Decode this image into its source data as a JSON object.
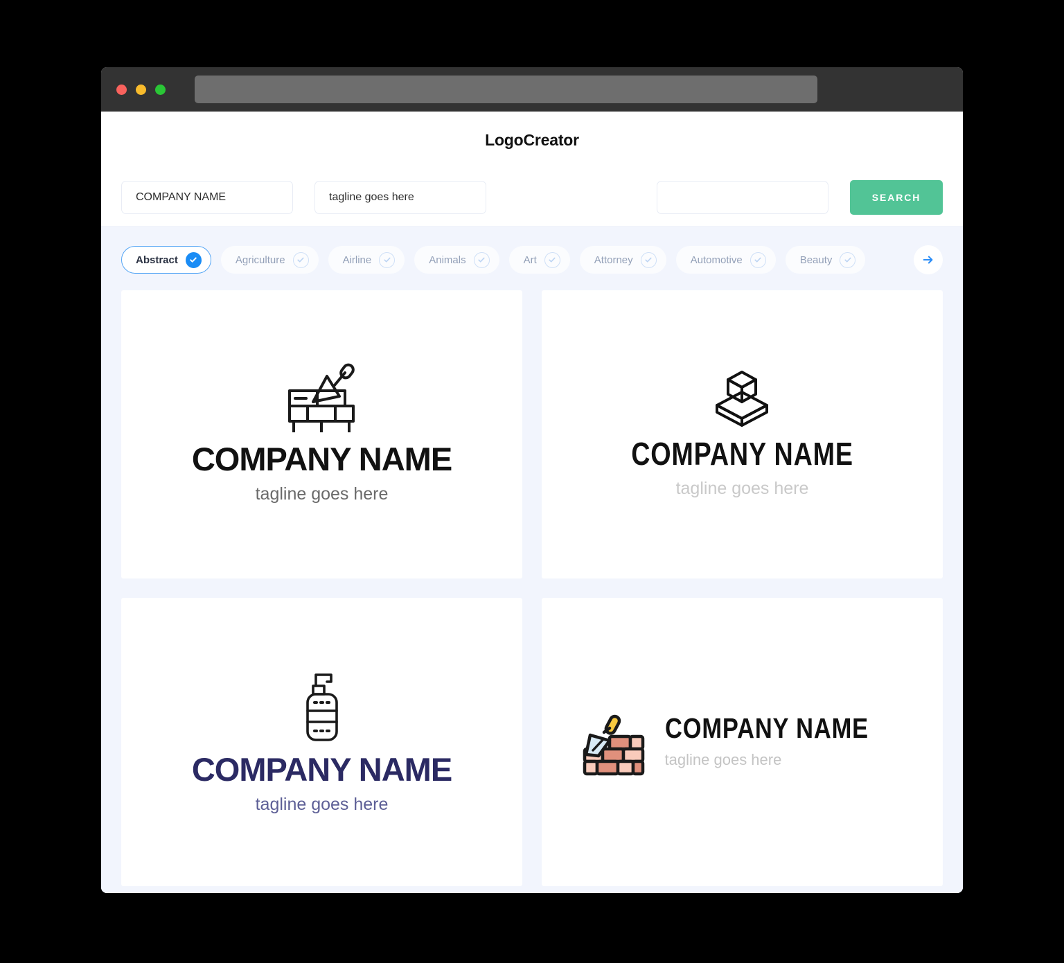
{
  "window": {
    "traffic_lights": [
      "close",
      "minimize",
      "maximize"
    ],
    "address_bar_value": ""
  },
  "header": {
    "title": "LogoCreator"
  },
  "search": {
    "company_value": "COMPANY NAME",
    "company_placeholder": "COMPANY NAME",
    "tagline_value": "tagline goes here",
    "tagline_placeholder": "tagline goes here",
    "keyword_value": "",
    "keyword_placeholder": "",
    "search_label": "SEARCH"
  },
  "categories": {
    "items": [
      {
        "label": "Abstract",
        "selected": true
      },
      {
        "label": "Agriculture",
        "selected": false
      },
      {
        "label": "Airline",
        "selected": false
      },
      {
        "label": "Animals",
        "selected": false
      },
      {
        "label": "Art",
        "selected": false
      },
      {
        "label": "Attorney",
        "selected": false
      },
      {
        "label": "Automotive",
        "selected": false
      },
      {
        "label": "Beauty",
        "selected": false
      }
    ],
    "next_icon": "arrow-right-icon"
  },
  "results": {
    "cards": [
      {
        "icon": "brick-wall-trowel-outline-icon",
        "name": "COMPANY NAME",
        "tagline": "tagline goes here",
        "layout": "stacked",
        "name_color": "#111111",
        "tagline_color": "#6a6a6a"
      },
      {
        "icon": "isometric-cube-stack-icon",
        "name": "COMPANY NAME",
        "tagline": "tagline goes here",
        "layout": "stacked",
        "name_color": "#111111",
        "tagline_color": "#c9c9c9"
      },
      {
        "icon": "soap-dispenser-outline-icon",
        "name": "COMPANY NAME",
        "tagline": "tagline goes here",
        "layout": "stacked",
        "name_color": "#2b2a63",
        "tagline_color": "#5d5f96"
      },
      {
        "icon": "brick-wall-trowel-color-icon",
        "name": "COMPANY NAME",
        "tagline": "tagline goes here",
        "layout": "horizontal",
        "name_color": "#111111",
        "tagline_color": "#c4c4c4"
      }
    ]
  },
  "colors": {
    "accent_green": "#52c496",
    "accent_blue": "#1a8cf5",
    "page_background": "#f2f5fd",
    "brick_light": "#f9cbbb",
    "brick_dark": "#e0907c",
    "trowel_blade": "#d8eaf5",
    "trowel_handle": "#f8c93f"
  }
}
